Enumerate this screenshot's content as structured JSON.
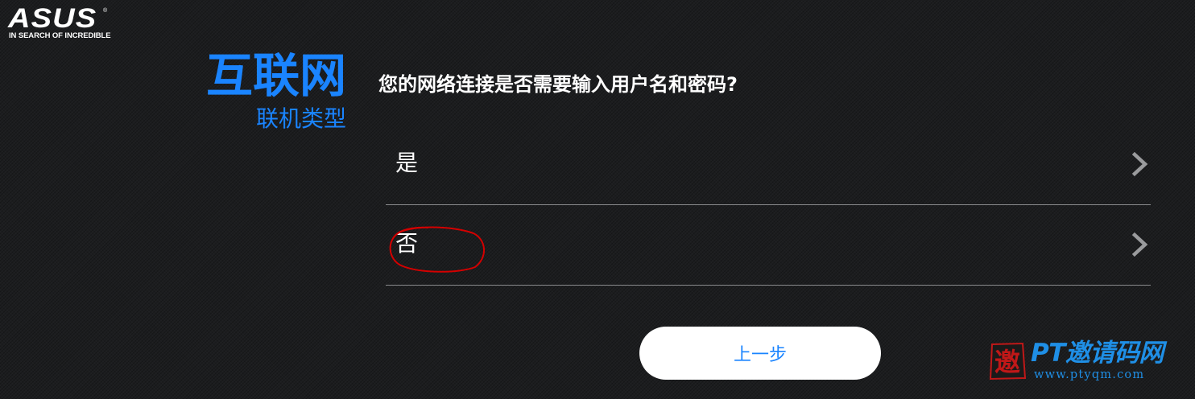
{
  "brand": {
    "logo_text": "ASUS",
    "registered_mark": "®",
    "tagline": "IN SEARCH OF INCREDIBLE"
  },
  "header": {
    "title": "互联网",
    "subtitle": "联机类型"
  },
  "question": "您的网络连接是否需要输入用户名和密码?",
  "options": [
    {
      "label": "是",
      "icon": "chevron-right-icon"
    },
    {
      "label": "否",
      "icon": "chevron-right-icon"
    }
  ],
  "back_button": {
    "label": "上一步"
  },
  "annotation": {
    "circle_color": "#d40000"
  },
  "watermark": {
    "seal_char": "邀",
    "text": "PT邀请码网",
    "url": "www.ptyqm.com"
  },
  "colors": {
    "accent": "#1a84ff",
    "background": "#1c1d1f",
    "divider": "#8a8b8d",
    "watermark": "#1f8fe6"
  }
}
